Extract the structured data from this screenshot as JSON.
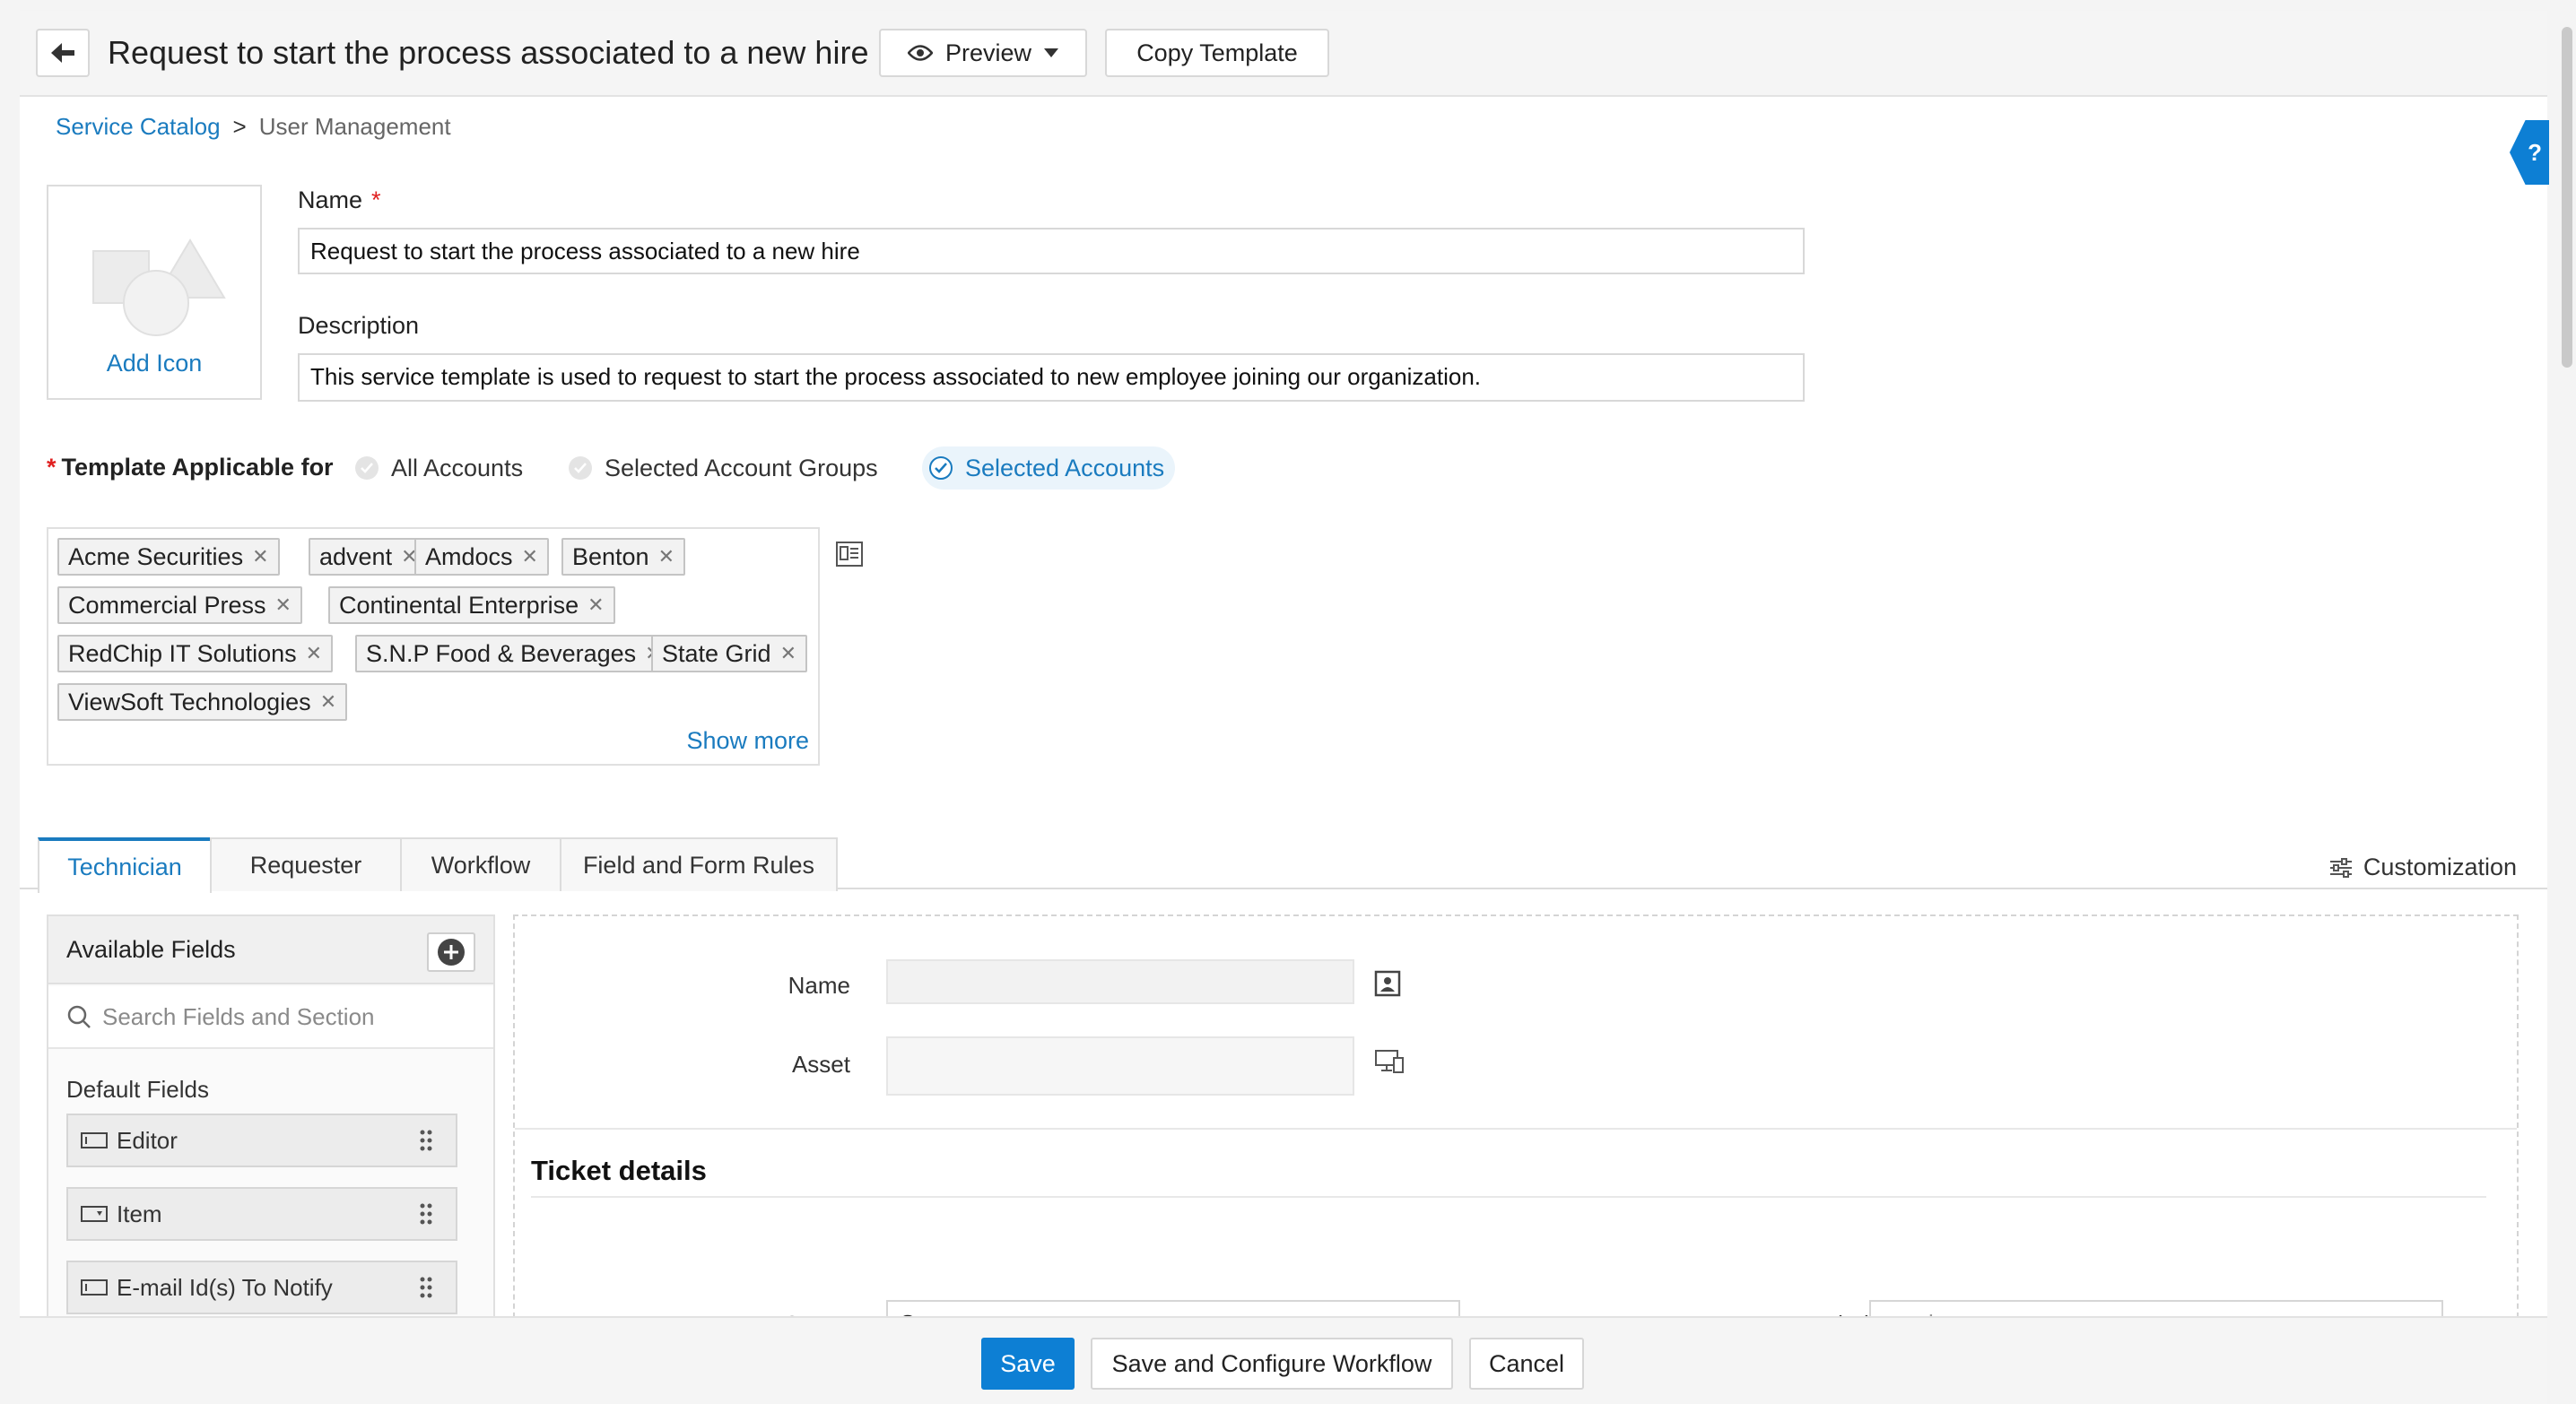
{
  "header": {
    "title": "Request to start the process associated to a new hire",
    "preview_label": "Preview",
    "copy_template_label": "Copy Template"
  },
  "breadcrumb": {
    "root": "Service Catalog",
    "separator": ">",
    "current": "User Management"
  },
  "icon_box": {
    "label": "Add Icon"
  },
  "form": {
    "name_label": "Name",
    "name_value": "Request to start the process associated to a new hire",
    "description_label": "Description",
    "description_value": "This service template is used to request to start the process associated to new employee joining our organization."
  },
  "applicable": {
    "label": "Template Applicable for",
    "options": [
      "All Accounts",
      "Selected Account Groups",
      "Selected Accounts"
    ],
    "selected": "Selected Accounts"
  },
  "accounts": {
    "tags": [
      "Acme Securities",
      "advent",
      "Amdocs",
      "Benton",
      "Commercial Press",
      "Continental Enterprise",
      "RedChip IT Solutions",
      "S.N.P Food & Beverages",
      "State Grid",
      "ViewSoft Technologies"
    ],
    "show_more": "Show more"
  },
  "tabs": {
    "items": [
      "Technician",
      "Requester",
      "Workflow",
      "Field and Form Rules"
    ],
    "active": "Technician",
    "customization": "Customization"
  },
  "available_fields": {
    "title": "Available Fields",
    "search_placeholder": "Search Fields and Section",
    "group": "Default Fields",
    "items": [
      "Editor",
      "Item",
      "E-mail Id(s) To Notify"
    ]
  },
  "canvas": {
    "name_label": "Name",
    "asset_label": "Asset",
    "section_title": "Ticket details",
    "status_label": "Status",
    "status_value": "Open",
    "priority_label": "Priority",
    "priority_value": "-- select --"
  },
  "footer": {
    "save": "Save",
    "save_configure": "Save and Configure Workflow",
    "cancel": "Cancel"
  },
  "help": {
    "label": "?"
  },
  "colors": {
    "accent": "#0d7fd4",
    "link": "#1a7bbf",
    "required": "#e02020"
  }
}
